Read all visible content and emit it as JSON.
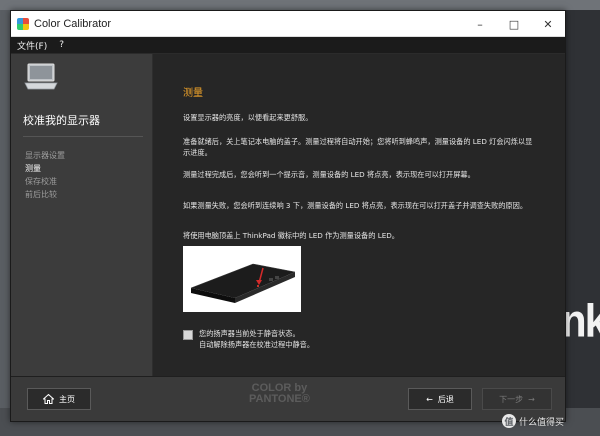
{
  "window": {
    "title": "Color Calibrator",
    "minimize_glyph": "–",
    "maximize_glyph": "□",
    "close_glyph": "✕"
  },
  "menu": {
    "items": [
      "文件(F)",
      "?"
    ]
  },
  "sidebar": {
    "title": "校准我的显示器",
    "steps": [
      {
        "label": "显示器设置",
        "active": false
      },
      {
        "label": "测量",
        "active": true
      },
      {
        "label": "保存校准",
        "active": false
      },
      {
        "label": "前后比较",
        "active": false
      }
    ]
  },
  "main": {
    "section_title": "测量",
    "paragraphs": [
      "设置显示器的亮度，以便看起来更舒服。",
      "准备就绪后，关上笔记本电脑的盖子。测量过程将自动开始；您将听到蜂鸣声，测量设备的 LED 灯会闪烁以显示进度。",
      "测量过程完成后，您会听到一个提示音，测量设备的 LED 将点亮，表示现在可以打开屏幕。",
      "如果测量失败，您会听到连续响 3 下，测量设备的 LED 将点亮，表示现在可以打开盖子并调查失败的原因。",
      "将使用电脑顶盖上 ThinkPad 徽标中的 LED 作为测量设备的 LED。"
    ],
    "mute_checkbox": {
      "line1": "您的扬声器当前处于静音状态。",
      "line2": "自动解除扬声器在校准过程中静音。",
      "checked": false
    }
  },
  "footer": {
    "home_label": "主页",
    "back_label": "后退",
    "next_label": "下一步",
    "brand_line1": "COLOR by",
    "brand_line2": "PANTONE®"
  },
  "desktop": {
    "watermark_text": "什么值得买",
    "watermark_badge": "值"
  },
  "colors": {
    "accent": "#f4a62a",
    "window_bg": "#262626",
    "sidebar_bg": "#3c3c3c"
  }
}
